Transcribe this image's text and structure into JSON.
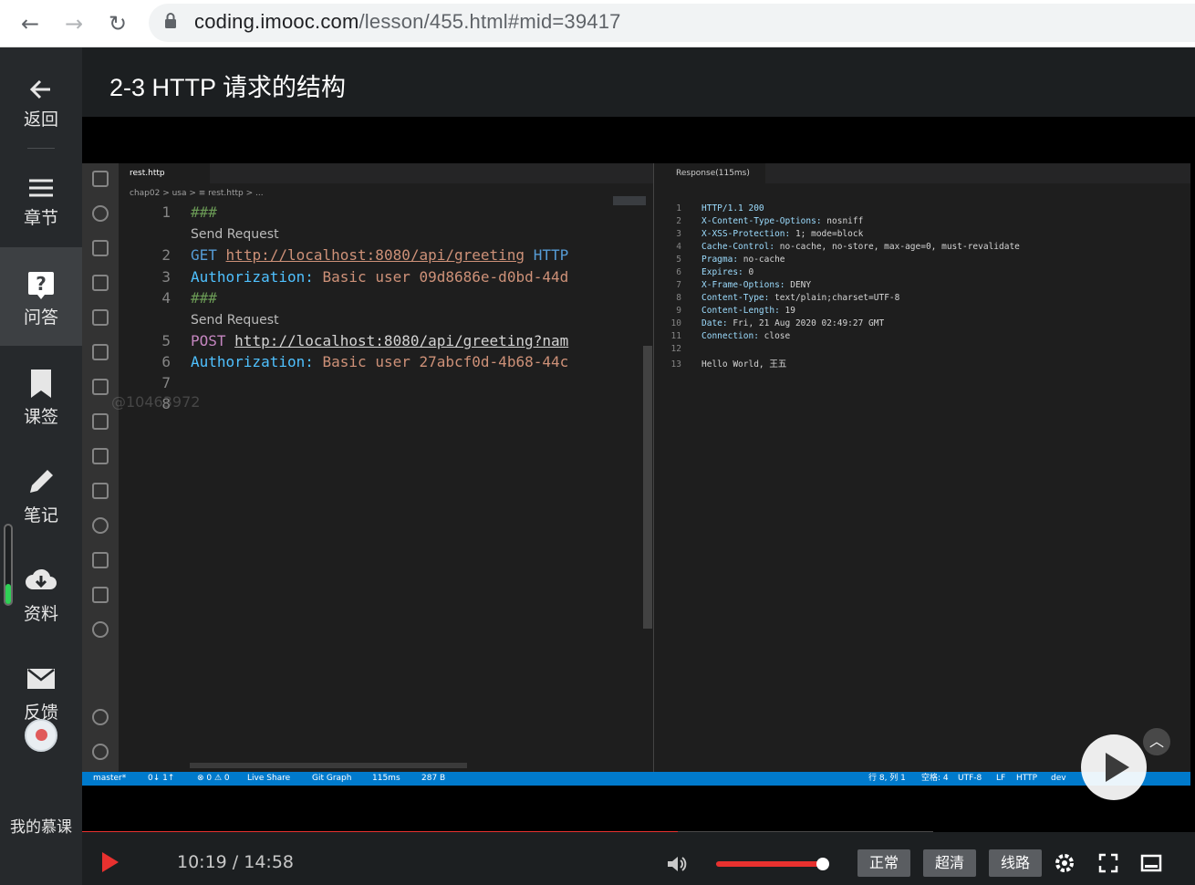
{
  "browser": {
    "url_host": "coding.imooc.com",
    "url_path": "/lesson/455.html#mid=39417"
  },
  "sidebar": {
    "items": [
      {
        "label": "返回",
        "icon": "arrow-left-icon"
      },
      {
        "label": "章节",
        "icon": "menu-icon"
      },
      {
        "label": "问答",
        "icon": "question-icon"
      },
      {
        "label": "课签",
        "icon": "bookmark-icon"
      },
      {
        "label": "笔记",
        "icon": "pencil-icon"
      },
      {
        "label": "资料",
        "icon": "cloud-download-icon"
      },
      {
        "label": "反馈",
        "icon": "mail-icon"
      },
      {
        "label": "我的慕课",
        "icon": "avatar"
      }
    ],
    "active_index": 2
  },
  "lesson": {
    "title": "2-3 HTTP 请求的结构"
  },
  "vscode": {
    "tab_name": "rest.http",
    "breadcrumb": "chap02 > usa > ≡ rest.http > ...",
    "response_tab": "Response(115ms)",
    "code": {
      "l1": "###",
      "lens1": "Send Request",
      "l2_method": "GET",
      "l2_url": "http://localhost:8080/api/greeting",
      "l2_ver": "HTTP",
      "l3_key": "Authorization:",
      "l3_scheme": "Basic",
      "l3_user": "user",
      "l3_val": "09d8686e-d0bd-44d",
      "l4": "###",
      "lens2": "Send Request",
      "l5_method": "POST",
      "l5_url": "http://localhost:8080/api/greeting?nam",
      "l6_key": "Authorization:",
      "l6_scheme": "Basic",
      "l6_user": "user",
      "l6_val": "27abcf0d-4b68-44c"
    },
    "line_numbers": [
      "1",
      "2",
      "3",
      "4",
      "5",
      "6",
      "7",
      "8"
    ],
    "watermark": "@10463972",
    "response": [
      {
        "n": "1",
        "h": "HTTP/1.1 200",
        "v": ""
      },
      {
        "n": "2",
        "h": "X-Content-Type-Options:",
        "v": " nosniff"
      },
      {
        "n": "3",
        "h": "X-XSS-Protection:",
        "v": " 1; mode=block"
      },
      {
        "n": "4",
        "h": "Cache-Control:",
        "v": " no-cache, no-store, max-age=0, must-revalidate"
      },
      {
        "n": "5",
        "h": "Pragma:",
        "v": " no-cache"
      },
      {
        "n": "6",
        "h": "Expires:",
        "v": " 0"
      },
      {
        "n": "7",
        "h": "X-Frame-Options:",
        "v": " DENY"
      },
      {
        "n": "8",
        "h": "Content-Type:",
        "v": " text/plain;charset=UTF-8"
      },
      {
        "n": "9",
        "h": "Content-Length:",
        "v": " 19"
      },
      {
        "n": "10",
        "h": "Date:",
        "v": " Fri, 21 Aug 2020 02:49:27 GMT"
      },
      {
        "n": "11",
        "h": "Connection:",
        "v": " close"
      },
      {
        "n": "12",
        "h": "",
        "v": ""
      },
      {
        "n": "13",
        "h": "",
        "v": "Hello World, 王五"
      }
    ],
    "status": {
      "branch": "master*",
      "sync": "0↓ 1↑",
      "problems": "⊗ 0 ⚠ 0",
      "live": "Live Share",
      "git": "Git Graph",
      "time": "115ms",
      "size": "287 B",
      "pos": "行 8, 列 1",
      "spaces": "空格: 4",
      "enc": "UTF-8",
      "eol": "LF",
      "lang": "HTTP",
      "env": "dev"
    }
  },
  "player": {
    "time": "10:19 / 14:58",
    "progress": 0.7,
    "volume": 0.98,
    "quality_normal": "正常",
    "quality_hd": "超清",
    "route": "线路"
  }
}
